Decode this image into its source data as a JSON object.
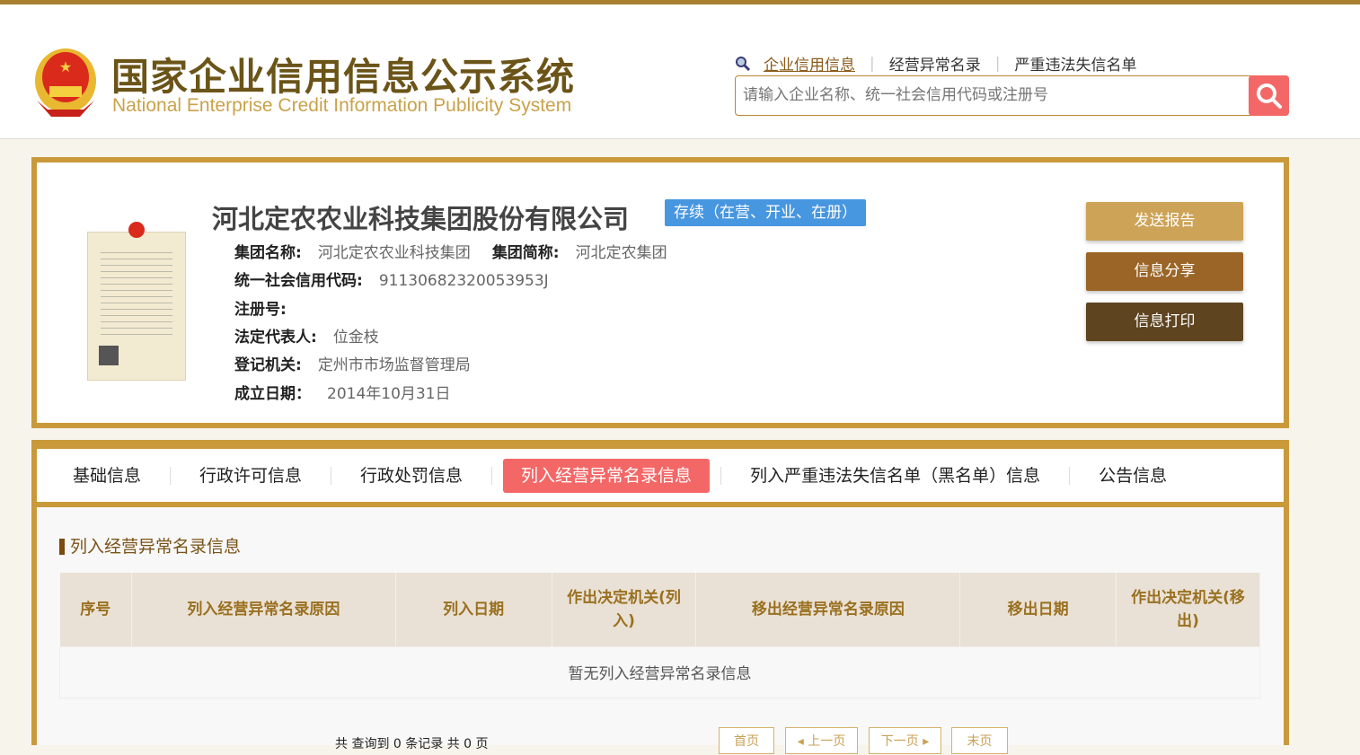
{
  "header": {
    "title_cn": "国家企业信用信息公示系统",
    "title_en": "National Enterprise Credit Information Publicity System",
    "nav": [
      "企业信用信息",
      "经营异常名录",
      "严重违法失信名单"
    ],
    "search_placeholder": "请输入企业名称、统一社会信用代码或注册号"
  },
  "company": {
    "name": "河北定农农业科技集团股份有限公司",
    "status": "存续（在营、开业、在册）",
    "group_name_label": "集团名称:",
    "group_name": "河北定农农业科技集团",
    "group_short_label": "集团简称:",
    "group_short": "河北定农集团",
    "credit_code_label": "统一社会信用代码:",
    "credit_code": "91130682320053953J",
    "reg_no_label": "注册号:",
    "legal_rep_label": "法定代表人:",
    "legal_rep": "位金枝",
    "authority_label": "登记机关:",
    "authority": "定州市市场监督管理局",
    "found_date_label": "成立日期：",
    "found_date": "2014年10月31日"
  },
  "actions": [
    "发送报告",
    "信息分享",
    "信息打印"
  ],
  "tabs": [
    "基础信息",
    "行政许可信息",
    "行政处罚信息",
    "列入经营异常名录信息",
    "列入严重违法失信名单（黑名单）信息",
    "公告信息"
  ],
  "section": {
    "title": "列入经营异常名录信息",
    "columns": [
      "序号",
      "列入经营异常名录原因",
      "列入日期",
      "作出决定机关(列入)",
      "移出经营异常名录原因",
      "移出日期",
      "作出决定机关(移出)"
    ],
    "empty": "暂无列入经营异常名录信息"
  },
  "pager": {
    "info": "共 查询到 0 条记录 共 0 页",
    "first": "首页",
    "prev": "上一页",
    "next": "下一页",
    "last": "末页"
  }
}
